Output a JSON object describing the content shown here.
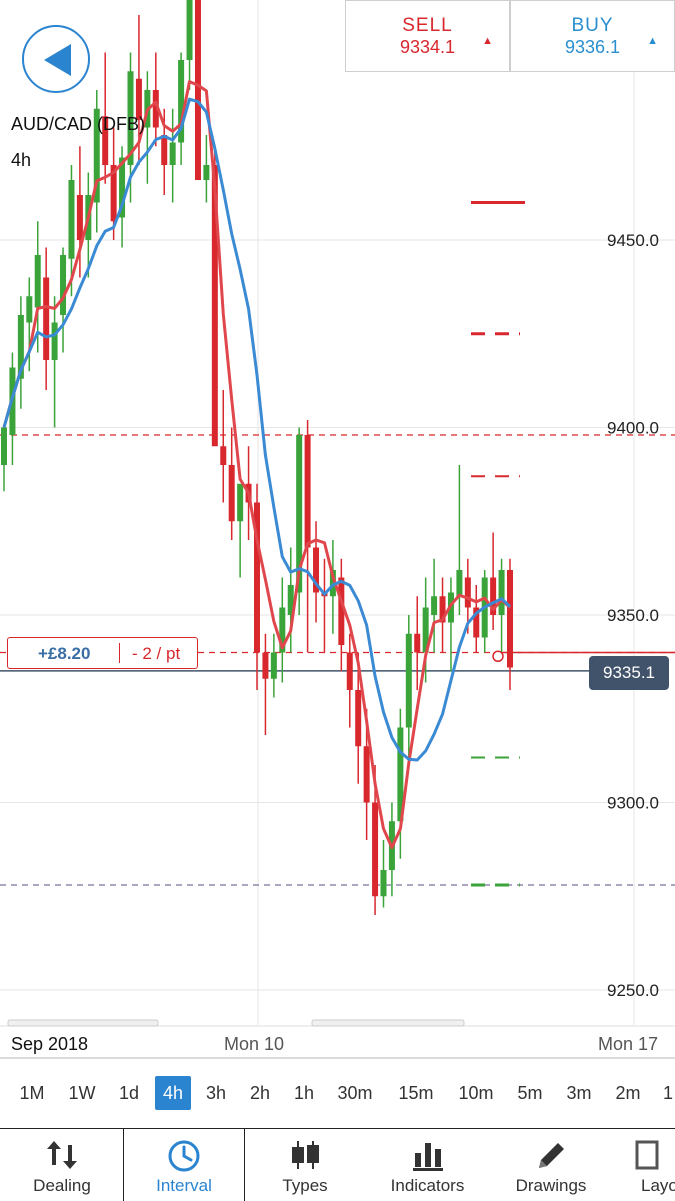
{
  "trade": {
    "sell_label": "SELL",
    "sell_price": "9334.1",
    "buy_label": "BUY",
    "buy_price": "9336.1"
  },
  "instrument": {
    "name": "AUD/CAD (DFB)",
    "timeframe": "4h"
  },
  "position": {
    "pnl": "+£8.20",
    "size": "- 2 / pt"
  },
  "current_price": "9335.1",
  "chart_data": {
    "type": "candlestick",
    "y_ticks": [
      "9450.0",
      "9400.0",
      "9350.0",
      "9300.0",
      "9250.0"
    ],
    "x_labels": [
      "Sep 2018",
      "Mon 10",
      "Mon 17"
    ],
    "ylim": [
      9238,
      9500
    ],
    "levels": [
      {
        "name": "reference",
        "price": 9398,
        "style": "dashed",
        "color": "#d8282e"
      },
      {
        "name": "position-open",
        "price": 9340,
        "style": "dashed",
        "color": "#d8282e"
      },
      {
        "name": "current",
        "price": 9335.1,
        "style": "solid",
        "color": "#40536a"
      },
      {
        "name": "lower",
        "price": 9278,
        "style": "dashed",
        "color": "#7a6f9a"
      }
    ],
    "candles": [
      [
        9390,
        9400,
        9383,
        9400
      ],
      [
        9398,
        9420,
        9390,
        9416
      ],
      [
        9413,
        9435,
        9405,
        9430
      ],
      [
        9428,
        9440,
        9415,
        9435
      ],
      [
        9432,
        9455,
        9420,
        9446
      ],
      [
        9440,
        9448,
        9410,
        9418
      ],
      [
        9418,
        9435,
        9400,
        9428
      ],
      [
        9430,
        9448,
        9420,
        9446
      ],
      [
        9445,
        9470,
        9435,
        9466
      ],
      [
        9462,
        9475,
        9440,
        9450
      ],
      [
        9450,
        9468,
        9440,
        9462
      ],
      [
        9460,
        9490,
        9452,
        9485
      ],
      [
        9483,
        9500,
        9465,
        9470
      ],
      [
        9470,
        9480,
        9450,
        9455
      ],
      [
        9456,
        9475,
        9448,
        9472
      ],
      [
        9470,
        9500,
        9460,
        9495
      ],
      [
        9493,
        9510,
        9470,
        9482
      ],
      [
        9480,
        9495,
        9465,
        9490
      ],
      [
        9490,
        9500,
        9475,
        9480
      ],
      [
        9478,
        9485,
        9462,
        9470
      ],
      [
        9470,
        9485,
        9460,
        9476
      ],
      [
        9476,
        9500,
        9470,
        9498
      ],
      [
        9498,
        9530,
        9490,
        9525
      ],
      [
        9520,
        9530,
        9480,
        9466
      ],
      [
        9466,
        9478,
        9460,
        9470
      ],
      [
        9470,
        9475,
        9440,
        9395
      ],
      [
        9395,
        9410,
        9380,
        9390
      ],
      [
        9390,
        9400,
        9370,
        9375
      ],
      [
        9375,
        9380,
        9360,
        9385
      ],
      [
        9385,
        9395,
        9370,
        9380
      ],
      [
        9380,
        9385,
        9330,
        9340
      ],
      [
        9340,
        9345,
        9318,
        9333
      ],
      [
        9333,
        9345,
        9328,
        9340
      ],
      [
        9340,
        9360,
        9332,
        9352
      ],
      [
        9350,
        9368,
        9340,
        9358
      ],
      [
        9356,
        9400,
        9350,
        9398
      ],
      [
        9398,
        9402,
        9340,
        9368
      ],
      [
        9368,
        9375,
        9348,
        9356
      ],
      [
        9356,
        9365,
        9340,
        9355
      ],
      [
        9355,
        9370,
        9345,
        9362
      ],
      [
        9360,
        9365,
        9335,
        9342
      ],
      [
        9340,
        9345,
        9320,
        9330
      ],
      [
        9330,
        9340,
        9305,
        9315
      ],
      [
        9315,
        9325,
        9290,
        9300
      ],
      [
        9300,
        9310,
        9270,
        9275
      ],
      [
        9275,
        9290,
        9272,
        9282
      ],
      [
        9282,
        9300,
        9275,
        9295
      ],
      [
        9295,
        9325,
        9285,
        9320
      ],
      [
        9320,
        9350,
        9310,
        9345
      ],
      [
        9345,
        9355,
        9330,
        9340
      ],
      [
        9340,
        9360,
        9332,
        9352
      ],
      [
        9350,
        9365,
        9340,
        9355
      ],
      [
        9355,
        9360,
        9340,
        9348
      ],
      [
        9348,
        9360,
        9335,
        9356
      ],
      [
        9355,
        9390,
        9350,
        9362
      ],
      [
        9360,
        9365,
        9345,
        9352
      ],
      [
        9352,
        9358,
        9340,
        9344
      ],
      [
        9344,
        9362,
        9340,
        9360
      ],
      [
        9360,
        9372,
        9346,
        9350
      ],
      [
        9350,
        9365,
        9340,
        9362
      ],
      [
        9362,
        9365,
        9330,
        9336
      ]
    ]
  },
  "intervals": [
    "1M",
    "1W",
    "1d",
    "4h",
    "3h",
    "2h",
    "1h",
    "30m",
    "15m",
    "10m",
    "5m",
    "3m",
    "2m",
    "1"
  ],
  "active_interval": "4h",
  "toolbar": [
    "Dealing",
    "Interval",
    "Types",
    "Indicators",
    "Drawings",
    "Layout"
  ],
  "colors": {
    "up": "#3aa33a",
    "down": "#d8282e",
    "ma_fast": "#e0474c",
    "ma_slow": "#3a8ad4",
    "accent": "#2a84d0"
  }
}
